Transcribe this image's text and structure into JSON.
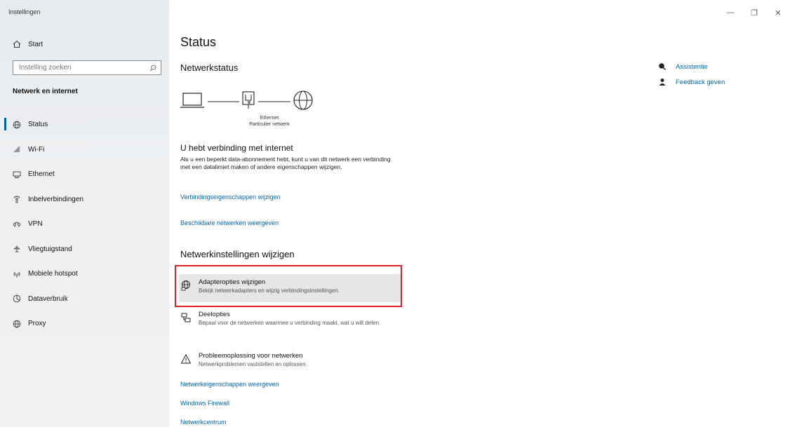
{
  "window": {
    "title": "Instellingen",
    "controls": {
      "minimize": "—",
      "restore": "❐",
      "close": "✕"
    }
  },
  "sidebar": {
    "home_label": "Start",
    "search_placeholder": "Instelling zoeken",
    "section_title": "Netwerk en internet",
    "items": [
      {
        "label": "Status",
        "icon": "globe-status-icon",
        "active": true
      },
      {
        "label": "Wi-Fi",
        "icon": "wifi-icon"
      },
      {
        "label": "Ethernet",
        "icon": "ethernet-icon"
      },
      {
        "label": "Inbelverbindingen",
        "icon": "dialup-icon"
      },
      {
        "label": "VPN",
        "icon": "vpn-icon"
      },
      {
        "label": "Vliegtuigstand",
        "icon": "airplane-icon"
      },
      {
        "label": "Mobiele hotspot",
        "icon": "hotspot-icon"
      },
      {
        "label": "Dataverbruik",
        "icon": "data-usage-icon"
      },
      {
        "label": "Proxy",
        "icon": "globe-icon"
      }
    ]
  },
  "main": {
    "page_title": "Status",
    "network_status_heading": "Netwerkstatus",
    "diagram": {
      "connection_name": "Ethernet",
      "network_type": "Particulier netwerk"
    },
    "connected_heading": "U hebt verbinding met internet",
    "connected_description": "Als u een beperkt data-abonnement hebt, kunt u van dit netwerk een verbinding met een datalimiet maken of andere eigenschappen wijzigen.",
    "link_connection_properties": "Verbindingseigenschappen wijzigen",
    "link_available_networks": "Beschikbare netwerken weergeven",
    "change_settings_heading": "Netwerkinstellingen wijzigen",
    "options": [
      {
        "title": "Adapteropties wijzigen",
        "desc": "Bekijk netwerkadapters en wijzig verbindingsinstellingen.",
        "icon": "adapter-globe-icon",
        "highlighted": true
      },
      {
        "title": "Deelopties",
        "desc": "Bepaal voor de netwerken waarmee u verbinding maakt, wat u wilt delen.",
        "icon": "sharing-icon"
      },
      {
        "title": "Probleemoplossing voor netwerken",
        "desc": "Netwerkproblemen vaststellen en oplossen.",
        "icon": "warning-icon"
      }
    ],
    "link_network_properties": "Netwerkeigenschappen weergeven",
    "link_firewall": "Windows Firewall",
    "link_network_center": "Netwerkcentrum"
  },
  "right": {
    "help_label": "Assistentie",
    "feedback_label": "Feedback geven"
  },
  "colors": {
    "accent": "#0063b1",
    "link": "#0066b4",
    "highlight_border": "#e02020"
  }
}
